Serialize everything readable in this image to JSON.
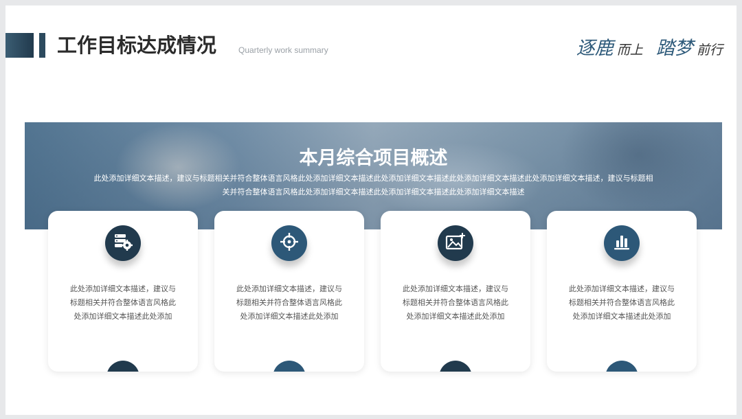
{
  "header": {
    "title": "工作目标达成情况",
    "subtitle": "Quarterly work summary",
    "motto": {
      "w1": "逐鹿",
      "w2": "而上",
      "w3": "踏梦",
      "w4": "前行"
    }
  },
  "banner": {
    "title": "本月综合项目概述",
    "description": "此处添加详细文本描述，建议与标题相关并符合整体语言风格此处添加详细文本描述此处添加详细文本描述此处添加详细文本描述此处添加详细文本描述，建议与标题相关并符合整体语言风格此处添加详细文本描述此处添加详细文本描述此处添加详细文本描述"
  },
  "cards": [
    {
      "icon": "server-gear-icon",
      "text": "此处添加详细文本描述，建议与标题相关并符合整体语言风格此处添加详细文本描述此处添加"
    },
    {
      "icon": "crosshair-target-icon",
      "text": "此处添加详细文本描述，建议与标题相关并符合整体语言风格此处添加详细文本描述此处添加"
    },
    {
      "icon": "image-add-icon",
      "text": "此处添加详细文本描述，建议与标题相关并符合整体语言风格此处添加详细文本描述此处添加"
    },
    {
      "icon": "bar-chart-icon",
      "text": "此处添加详细文本描述，建议与标题相关并符合整体语言风格此处添加详细文本描述此处添加"
    }
  ],
  "colors": {
    "accent_dark": "#213a4d",
    "accent_blue": "#2d5878",
    "motto_blue": "#2e5a7a"
  }
}
